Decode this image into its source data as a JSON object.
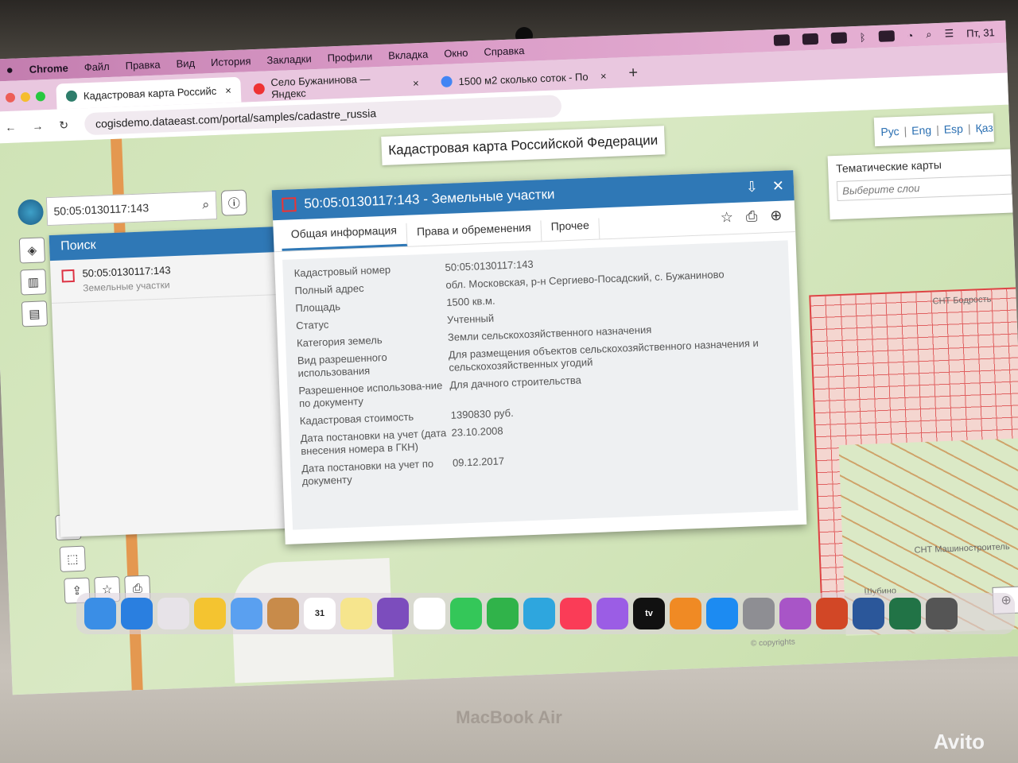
{
  "menubar": {
    "apple": "",
    "app": "Chrome",
    "items": [
      "Файл",
      "Правка",
      "Вид",
      "История",
      "Закладки",
      "Профили",
      "Вкладка",
      "Окно",
      "Справка"
    ],
    "clock": "Пт, 31"
  },
  "tabs": [
    {
      "label": "Кадастровая карта Российс",
      "close": "×"
    },
    {
      "label": "Село Бужанинова — Яндекс",
      "close": "×"
    },
    {
      "label": "1500 м2 сколько соток - По",
      "close": "×"
    }
  ],
  "tab_add": "+",
  "address": {
    "back": "←",
    "forward": "→",
    "reload": "↻",
    "url": "cogisdemo.dataeast.com/portal/samples/cadastre_russia"
  },
  "page": {
    "title": "Кадастровая карта Российской Федерации",
    "langs": [
      "Рус",
      "Eng",
      "Esp",
      "Қаз"
    ],
    "thematic": {
      "title": "Тематические карты",
      "placeholder": "Выберите слои"
    },
    "search_value": "50:05:0130117:143",
    "search_panel": {
      "header": "Поиск",
      "item_number": "50:05:0130117:143",
      "item_sub": "Земельные участки"
    },
    "copyright": "© copyrights"
  },
  "dialog": {
    "title": "50:05:0130117:143 - Земельные участки",
    "tabs": [
      "Общая информация",
      "Права и обременения",
      "Прочее"
    ],
    "rows": [
      {
        "k": "Кадастровый номер",
        "v": "50:05:0130117:143"
      },
      {
        "k": "Полный адрес",
        "v": "обл. Московская, р-н Сергиево-Посадский, с. Бужаниново"
      },
      {
        "k": "Площадь",
        "v": "1500 кв.м."
      },
      {
        "k": "Статус",
        "v": "Учтенный"
      },
      {
        "k": "Категория земель",
        "v": "Земли сельскохозяйственного назначения"
      },
      {
        "k": "Вид разрешенного использования",
        "v": "Для размещения объектов сельскохозяйственного назначения и сельскохозяйственных угодий"
      },
      {
        "k": "Разрешенное использова-ние по документу",
        "v": "Для дачного строительства"
      },
      {
        "k": "Кадастровая стоимость",
        "v": "1390830 руб."
      },
      {
        "k": "Дата постановки на учет (дата внесения номера в ГКН)",
        "v": "23.10.2008"
      },
      {
        "k": "Дата постановки на учет по документу",
        "v": "09.12.2017"
      }
    ]
  },
  "map_labels": [
    "СНТ Машиностроитель",
    "Шубино",
    "СНТ Бодрость"
  ],
  "dock": [
    "Finder",
    "Safari",
    "Launchpad",
    "Chrome",
    "Mail",
    "Contacts",
    "31",
    "Notes",
    "Viber",
    "Reminders",
    "Messages",
    "FaceTime",
    "Telegram",
    "Music",
    "Podcasts",
    "tv",
    "Books",
    "App Store",
    "Settings",
    "Feedback",
    "PowerPoint",
    "Word",
    "Excel",
    "Preview"
  ],
  "device_label": "MacBook Air",
  "watermark": "Avito"
}
